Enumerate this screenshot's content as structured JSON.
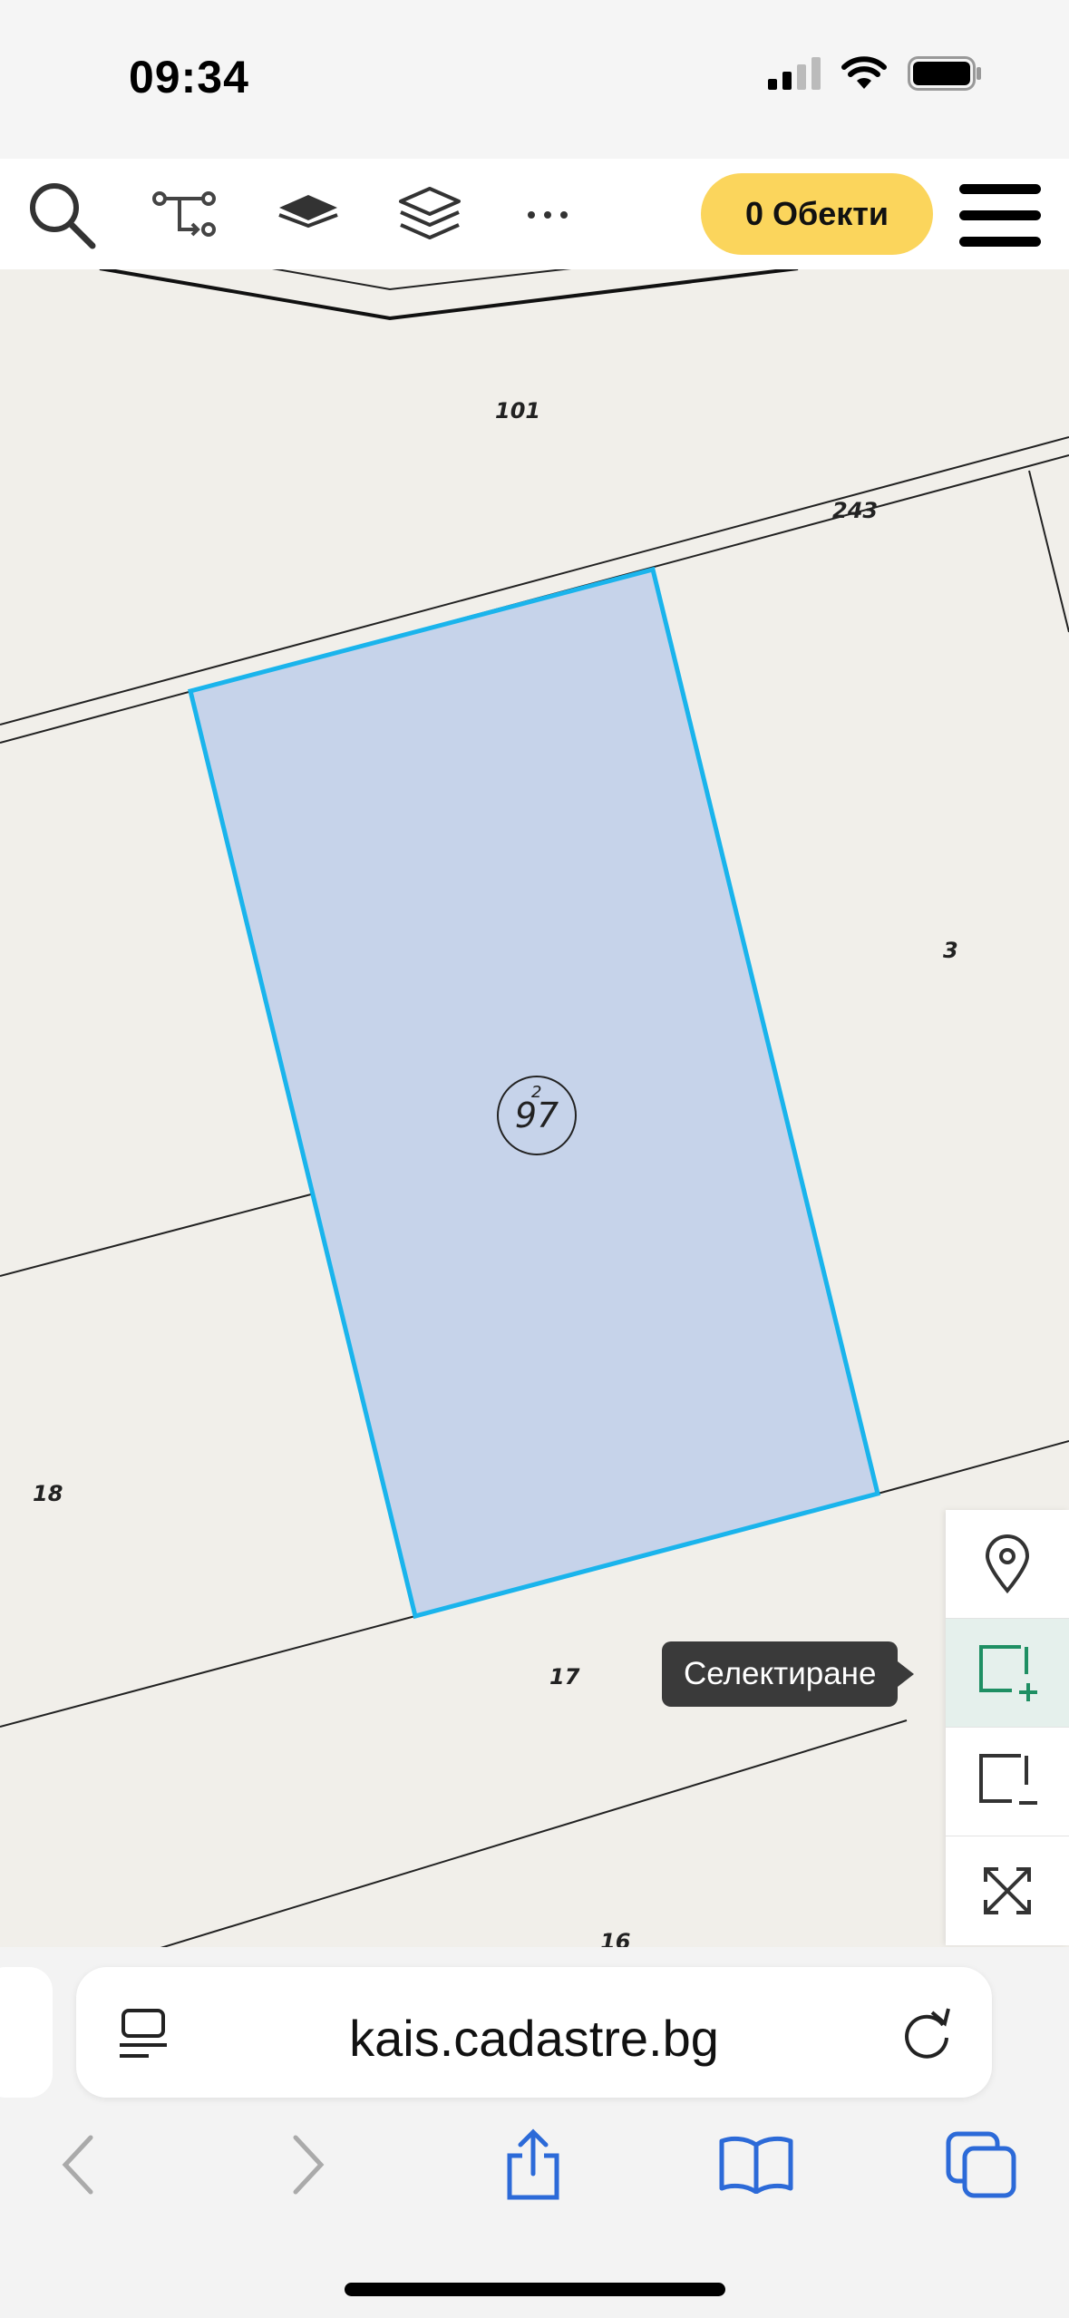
{
  "status_bar": {
    "time": "09:34"
  },
  "toolbar": {
    "objects_button": "0 Обекти"
  },
  "map": {
    "labels": {
      "l101": "101",
      "l243": "243",
      "l3": "3",
      "l18": "18",
      "l17": "17",
      "l16": "16"
    },
    "parcel": {
      "number": "97",
      "sub": "2"
    },
    "selection_stroke": "#1ab4ec",
    "selection_fill": "#c6d3ea"
  },
  "side_panel": {
    "tooltip": "Селектиране"
  },
  "browser": {
    "url": "kais.cadastre.bg"
  },
  "colors": {
    "accent_yellow": "#fbd55c",
    "select_green": "#1e8f63",
    "browser_blue": "#2c6ad8"
  }
}
